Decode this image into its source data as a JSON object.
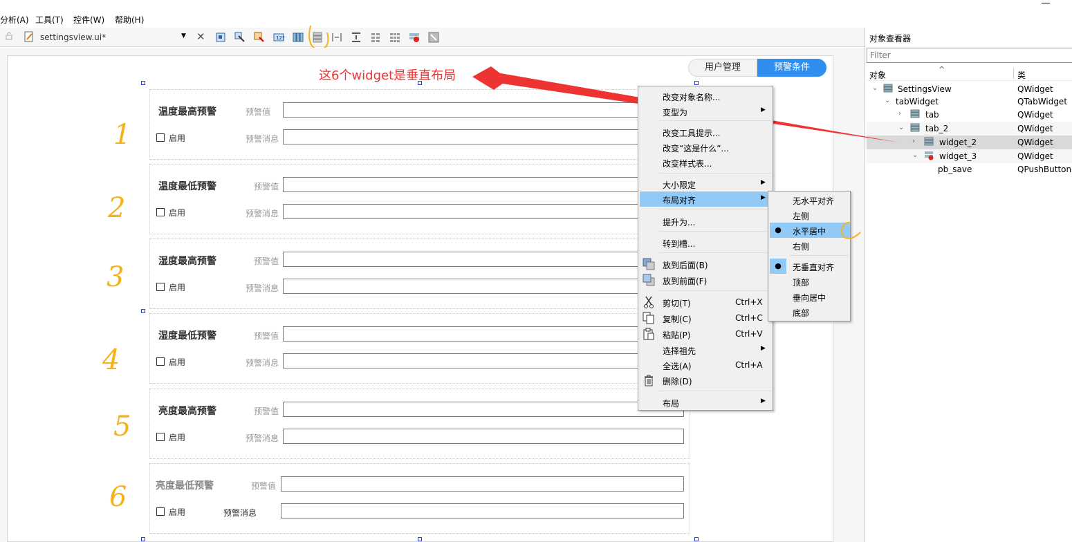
{
  "menubar": {
    "items": [
      "分析(A)",
      "工具(T)",
      "控件(W)",
      "帮助(H)"
    ]
  },
  "toolbar": {
    "file_name": "settingsview.ui*"
  },
  "form": {
    "tabs": [
      {
        "label": "用户管理",
        "active": false
      },
      {
        "label": "预警条件",
        "active": true
      }
    ],
    "groups": [
      {
        "title": "温度最高预警",
        "value_label": "预警值",
        "enable_label": "启用",
        "message_label": "预警消息",
        "number": "1"
      },
      {
        "title": "温度最低预警",
        "value_label": "预警值",
        "enable_label": "启用",
        "message_label": "预警消息",
        "number": "2"
      },
      {
        "title": "湿度最高预警",
        "value_label": "预警值",
        "enable_label": "启用",
        "message_label": "预警消息",
        "number": "3"
      },
      {
        "title": "湿度最低预警",
        "value_label": "预警值",
        "enable_label": "启用",
        "message_label": "预警消息",
        "number": "4"
      },
      {
        "title": "亮度最高预警",
        "value_label": "预警值",
        "enable_label": "启用",
        "message_label": "预警消息",
        "number": "5"
      },
      {
        "title": "亮度最低预警",
        "value_label": "预警值",
        "enable_label": "启用",
        "message_label": "预警消息",
        "number": "6"
      }
    ]
  },
  "annotation": {
    "text": "这6个widget是垂直布局",
    "color": "#ee3333"
  },
  "context_menu": {
    "items": [
      {
        "label": "改变对象名称..."
      },
      {
        "label": "变型为",
        "submenu": true
      },
      {
        "label": "改变工具提示..."
      },
      {
        "label": "改变“这是什么”..."
      },
      {
        "label": "改变样式表..."
      },
      {
        "label": "大小限定",
        "submenu": true
      },
      {
        "label": "布局对齐",
        "submenu": true,
        "highlighted": true
      },
      {
        "label": "提升为..."
      },
      {
        "label": "转到槽..."
      },
      {
        "label": "放到后面(B)",
        "icon": "send-back-icon"
      },
      {
        "label": "放到前面(F)",
        "icon": "bring-front-icon"
      },
      {
        "label": "剪切(T)",
        "shortcut": "Ctrl+X",
        "icon": "scissors-icon"
      },
      {
        "label": "复制(C)",
        "shortcut": "Ctrl+C",
        "icon": "copy-icon"
      },
      {
        "label": "粘贴(P)",
        "shortcut": "Ctrl+V",
        "icon": "paste-icon"
      },
      {
        "label": "选择祖先",
        "submenu": true
      },
      {
        "label": "全选(A)",
        "shortcut": "Ctrl+A"
      },
      {
        "label": "删除(D)",
        "icon": "trash-icon"
      },
      {
        "label": "布局",
        "submenu": true
      }
    ]
  },
  "align_submenu": {
    "items": [
      {
        "label": "无水平对齐",
        "checked": false
      },
      {
        "label": "左侧",
        "checked": false
      },
      {
        "label": "水平居中",
        "checked": true,
        "highlighted": true
      },
      {
        "label": "右侧",
        "checked": false
      },
      {
        "label": "无垂直对齐",
        "checked": true
      },
      {
        "label": "顶部",
        "checked": false
      },
      {
        "label": "垂向居中",
        "checked": false
      },
      {
        "label": "底部",
        "checked": false
      }
    ],
    "bullet": "●"
  },
  "object_inspector": {
    "title": "对象查看器",
    "filter_placeholder": "Filter",
    "col_object": "对象",
    "col_class": "类",
    "rows": [
      {
        "name": "SettingsView",
        "class": "QWidget"
      },
      {
        "name": "tabWidget",
        "class": "QTabWidget"
      },
      {
        "name": "tab",
        "class": "QWidget"
      },
      {
        "name": "tab_2",
        "class": "QWidget"
      },
      {
        "name": "widget_2",
        "class": "QWidget"
      },
      {
        "name": "widget_3",
        "class": "QWidget"
      },
      {
        "name": "pb_save",
        "class": "QPushButton"
      }
    ]
  },
  "colors": {
    "accent": "#2f8fef",
    "highlight": "#91c9f7",
    "handwriting": "#f6b21a"
  }
}
